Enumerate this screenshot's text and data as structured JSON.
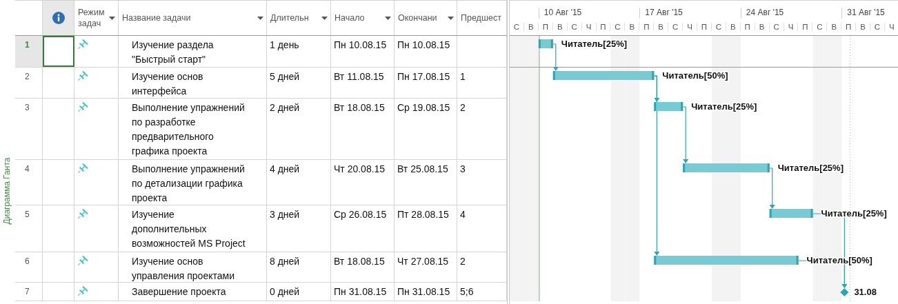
{
  "side_label": "Диаграмма Ганта",
  "columns": [
    {
      "kind": "info"
    },
    {
      "kind": "mode",
      "label": "Режим задач",
      "dropdown": true
    },
    {
      "kind": "name",
      "label": "Название задачи",
      "dropdown": true
    },
    {
      "kind": "duration",
      "label": "Длительн",
      "dropdown": true
    },
    {
      "kind": "start",
      "label": "Начало",
      "dropdown": true
    },
    {
      "kind": "finish",
      "label": "Окончани",
      "dropdown": true
    },
    {
      "kind": "pred",
      "label": "Предшест"
    }
  ],
  "timescale": {
    "weeks": [
      "10 Авг '15",
      "17 Авг '15",
      "24 Авг '15",
      "31 Авг '15"
    ],
    "days": [
      "С",
      "В",
      "П",
      "В",
      "С",
      "Ч",
      "П",
      "С",
      "В",
      "П",
      "В",
      "С",
      "Ч",
      "П",
      "С",
      "В",
      "П",
      "В",
      "С",
      "Ч",
      "П",
      "С",
      "В",
      "П",
      "В",
      "С",
      "Ч"
    ]
  },
  "tasks": [
    {
      "id": "1",
      "selected": true,
      "kind": "task",
      "name": "Изучение раздела\n\"Быстрый старт\"",
      "duration": "1 день",
      "start": "Пн 10.08.15",
      "finish": "Пн 10.08.15",
      "bar_label": "Читатель[25%]"
    },
    {
      "id": "2",
      "selected": false,
      "kind": "task",
      "name": "Изучение основ\nинтерфейса",
      "duration": "5 дней",
      "start": "Вт 11.08.15",
      "finish": "Пн 17.08.15",
      "predecessors": "1",
      "bar_label": "Читатель[50%]"
    },
    {
      "id": "3",
      "selected": false,
      "kind": "task",
      "name": "Выполнение упражнений\nпо разработке\nпредварительного\nграфика проекта",
      "duration": "2 дней",
      "start": "Вт 18.08.15",
      "finish": "Ср 19.08.15",
      "predecessors": "2",
      "bar_label": "Читатель[25%]"
    },
    {
      "id": "4",
      "selected": false,
      "kind": "task",
      "name": "Выполнение упражнений\nпо детализации графика\nпроекта",
      "duration": "4 дней",
      "start": "Чт 20.08.15",
      "finish": "Вт 25.08.15",
      "predecessors": "3",
      "bar_label": "Читатель[25%]"
    },
    {
      "id": "5",
      "selected": false,
      "kind": "task",
      "name": "Изучение\nдополнительных\nвозможностей MS Project",
      "duration": "3 дней",
      "start": "Ср 26.08.15",
      "finish": "Пт 28.08.15",
      "predecessors": "4",
      "bar_label": "Читатель[25%]"
    },
    {
      "id": "6",
      "selected": false,
      "kind": "task",
      "name": "Изучение основ\nуправления проектами",
      "duration": "8 дней",
      "start": "Вт 18.08.15",
      "finish": "Чт 27.08.15",
      "predecessors": "2",
      "bar_label": "Читатель[50%]"
    },
    {
      "id": "7",
      "selected": false,
      "kind": "milestone",
      "name": "Завершение проекта",
      "duration": "0 дней",
      "start": "Пн 31.08.15",
      "finish": "Пн 31.08.15",
      "predecessors": "5;6",
      "bar_label": "31.08"
    }
  ]
}
